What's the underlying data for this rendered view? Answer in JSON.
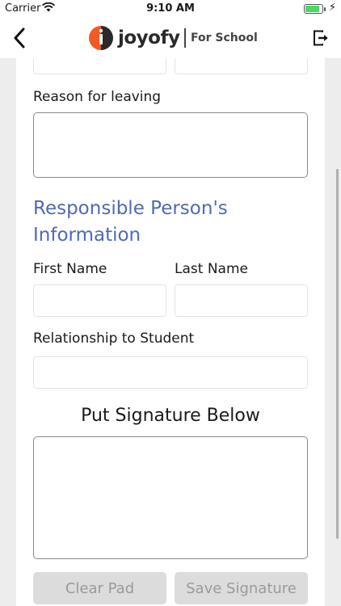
{
  "status_bar": {
    "carrier": "Carrier",
    "time": "9:10 AM",
    "battery_level": 0.85,
    "wifi_icon": "wifi-icon",
    "charging_icon": "charging-bolt-icon"
  },
  "nav": {
    "back_icon": "chevron-left-icon",
    "brand_name": "joyofy",
    "brand_sub": "For School",
    "logout_icon": "logout-icon"
  },
  "form": {
    "reason_label": "Reason for leaving",
    "reason_value": "",
    "section_title": "Responsible Person's Information",
    "first_name_label": "First Name",
    "first_name_value": "",
    "last_name_label": "Last Name",
    "last_name_value": "",
    "relationship_label": "Relationship to Student",
    "relationship_value": ""
  },
  "signature": {
    "title": "Put Signature Below",
    "clear_label": "Clear Pad",
    "save_label": "Save Signature"
  },
  "colors": {
    "accent": "#4f6ab5",
    "logo_orange": "#f15a24",
    "button_bg": "#dcdcdc",
    "button_text": "#9a9a9a"
  }
}
